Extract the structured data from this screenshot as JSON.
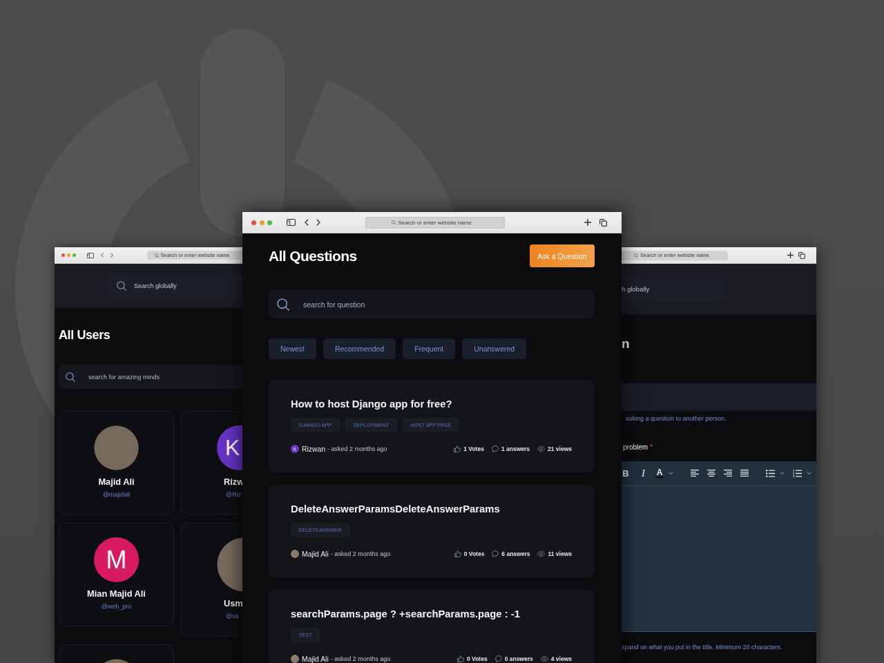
{
  "users_window": {
    "address_bar": {
      "placeholder": "Search or enter website name"
    },
    "global_search": {
      "placeholder": "Search globally"
    },
    "title": "All Users",
    "search": {
      "placeholder": "search for amazing minds"
    },
    "users": [
      {
        "name": "Majid Ali",
        "handle": "@majidali",
        "avatar": {
          "kind": "photo"
        }
      },
      {
        "name": "Rizw",
        "handle": "@Riz",
        "avatar": {
          "kind": "initial",
          "initial": "K",
          "color": "#6634c6"
        }
      },
      {
        "name": "Mian Majid Ali",
        "handle": "@web_pro",
        "avatar": {
          "kind": "initial",
          "initial": "M",
          "color": "#d81b60"
        }
      },
      {
        "name": "Usm",
        "handle": "@us",
        "avatar": {
          "kind": "photo"
        }
      },
      {
        "avatar": {
          "kind": "photo"
        }
      }
    ]
  },
  "questions_window": {
    "address_bar": {
      "placeholder": "Search or enter website name"
    },
    "title": "All Questions",
    "ask_button": "Ask a Question",
    "search": {
      "placeholder": "search for question"
    },
    "filters": [
      {
        "label": "Newest",
        "selected": false
      },
      {
        "label": "Recommended",
        "selected": false
      },
      {
        "label": "Frequent",
        "selected": false
      },
      {
        "label": "Unanswered",
        "selected": false
      }
    ],
    "questions": [
      {
        "title": "How to host Django app for free?",
        "tags": [
          "DJANGO APP",
          "DEPLOYMENT",
          "HOST APP FREE"
        ],
        "author": {
          "name": "Rizwan",
          "avatar": {
            "kind": "initial",
            "initial": "K",
            "color": "#6634c6"
          }
        },
        "asked": "- asked 2 months ago",
        "votes": "1 Votes",
        "answers": "1 answers",
        "views": "21 views"
      },
      {
        "title": "DeleteAnswerParamsDeleteAnswerParams",
        "tags": [
          "DELETEANSWER"
        ],
        "author": {
          "name": "Majid Ali",
          "avatar": {
            "kind": "photo"
          }
        },
        "asked": "- asked 2 months ago",
        "votes": "0 Votes",
        "answers": "6 answers",
        "views": "11 views"
      },
      {
        "title": "searchParams.page ? +searchParams.page : -1",
        "tags": [
          "TEST"
        ],
        "author": {
          "name": "Majid Ali",
          "avatar": {
            "kind": "photo"
          }
        },
        "asked": "- asked 2 months ago",
        "votes": "0 Votes",
        "answers": "0 answers",
        "views": "4 views"
      }
    ]
  },
  "ask_window": {
    "address_bar": {
      "placeholder": "Search or enter website name"
    },
    "global_search": {
      "placeholder": "h globally"
    },
    "title": "n",
    "title_hint": "asking a question to another person.",
    "details_label": {
      "text": "problem",
      "required_mark": "*"
    },
    "editor": {
      "toolbar": [
        {
          "kind": "bold",
          "label": "B"
        },
        {
          "kind": "italic",
          "label": "I"
        },
        {
          "kind": "text-color",
          "label": "A",
          "dropdown": true
        },
        {
          "kind": "align-left"
        },
        {
          "kind": "align-center"
        },
        {
          "kind": "align-right"
        },
        {
          "kind": "justify"
        },
        {
          "kind": "bullet-list",
          "dropdown": true
        },
        {
          "kind": "numbered-list",
          "dropdown": true
        }
      ]
    },
    "details_hint": "xpand on what you put in the title. Minimum 20 characters."
  }
}
